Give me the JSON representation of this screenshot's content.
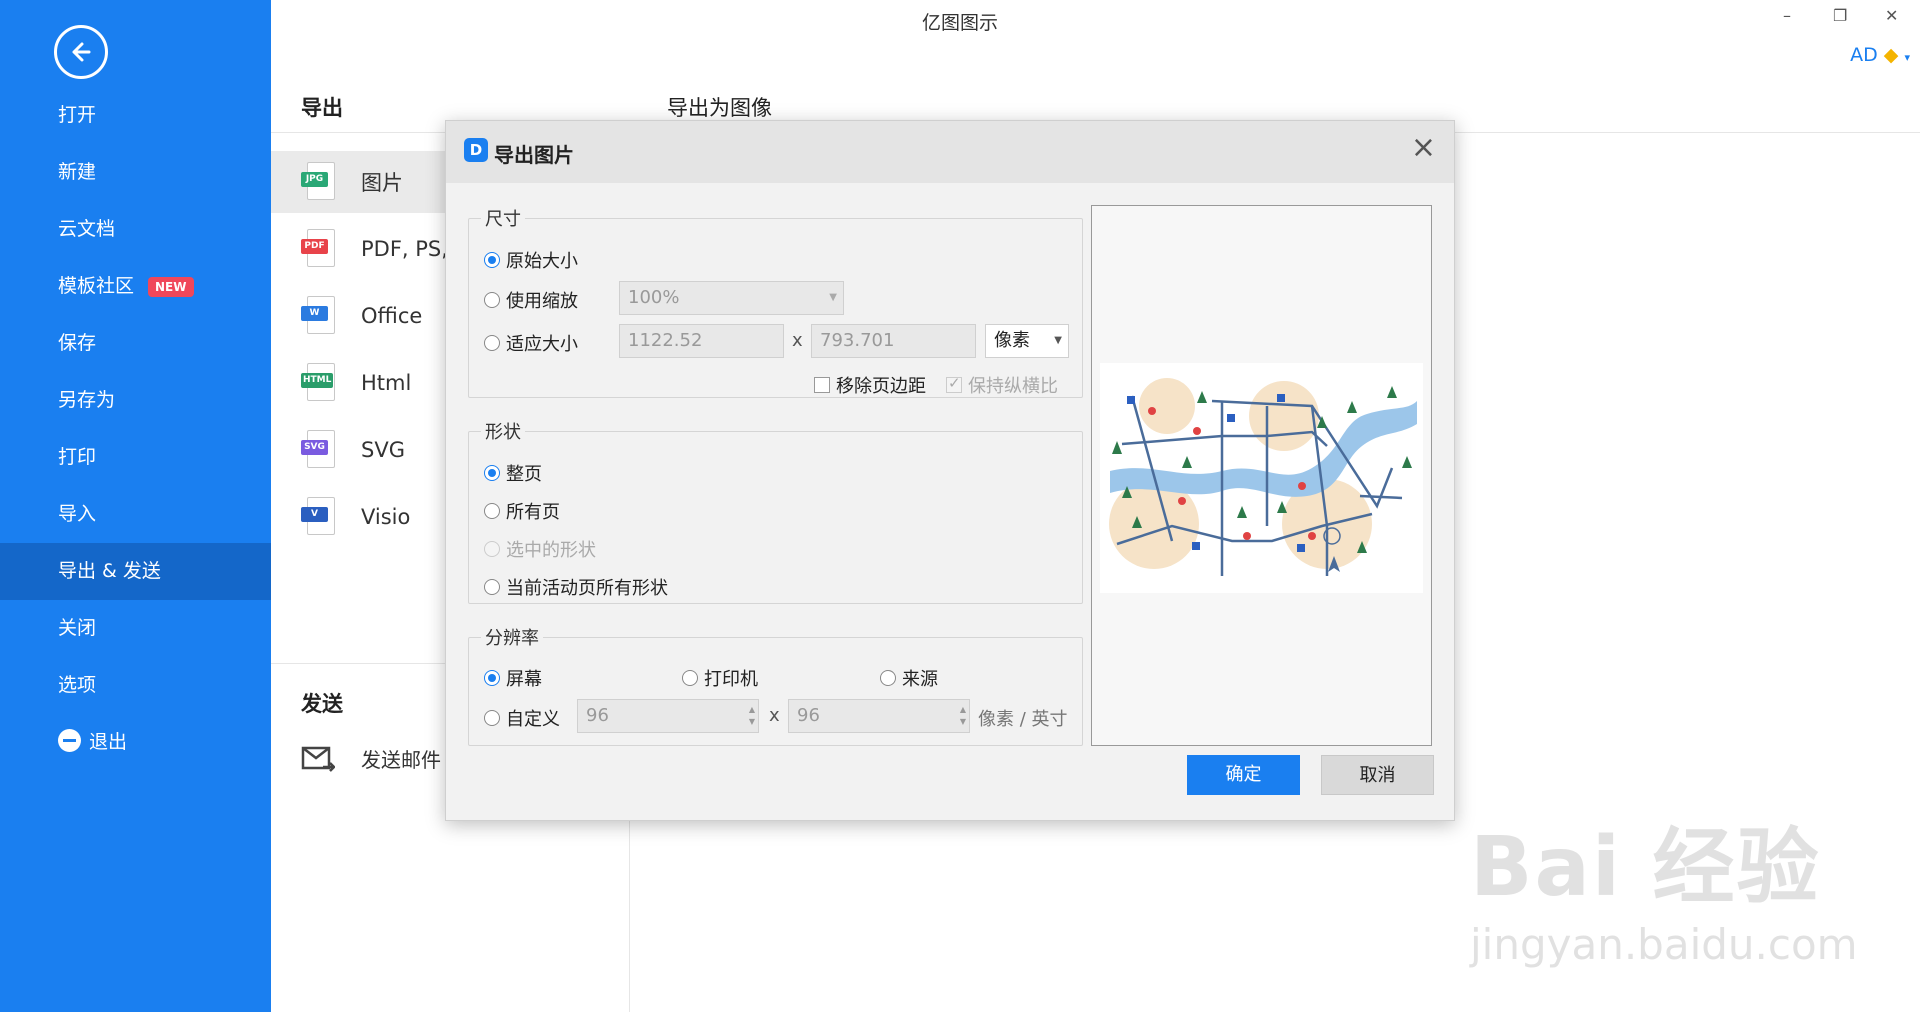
{
  "app": {
    "title": "亿图图示",
    "user": "AD"
  },
  "window_controls": {
    "minimize": "–",
    "restore": "❐",
    "close": "✕"
  },
  "sidebar": {
    "items": [
      {
        "label": "打开"
      },
      {
        "label": "新建"
      },
      {
        "label": "云文档"
      },
      {
        "label": "模板社区",
        "badge": "NEW"
      },
      {
        "label": "保存"
      },
      {
        "label": "另存为"
      },
      {
        "label": "打印"
      },
      {
        "label": "导入"
      },
      {
        "label": "导出 & 发送",
        "active": true
      },
      {
        "label": "关闭"
      },
      {
        "label": "选项"
      },
      {
        "label": "退出"
      }
    ]
  },
  "export": {
    "heading": "导出",
    "subheading": "导出为图像",
    "formats": [
      {
        "label": "图片",
        "tag": "JPG",
        "tag_color": "#2aa876",
        "active": true
      },
      {
        "label": "PDF, PS,",
        "tag": "PDF",
        "tag_color": "#e8434a"
      },
      {
        "label": "Office",
        "tag": "W",
        "tag_color": "#2b7be0"
      },
      {
        "label": "Html",
        "tag": "HTML",
        "tag_color": "#2a9d6a"
      },
      {
        "label": "SVG",
        "tag": "SVG",
        "tag_color": "#7a5be0"
      },
      {
        "label": "Visio",
        "tag": "V",
        "tag_color": "#2b5fc0"
      }
    ],
    "send_heading": "发送",
    "send_mail": "发送邮件"
  },
  "dialog": {
    "title": "导出图片",
    "size_group": {
      "legend": "尺寸",
      "original": "原始大小",
      "use_scale": "使用缩放",
      "scale_value": "100%",
      "fit_size": "适应大小",
      "width": "1122.52",
      "x": "x",
      "height": "793.701",
      "unit": "像素",
      "remove_margin": "移除页边距",
      "keep_ratio": "保持纵横比"
    },
    "shape_group": {
      "legend": "形状",
      "whole_page": "整页",
      "all_pages": "所有页",
      "selected_shapes": "选中的形状",
      "active_page_shapes": "当前活动页所有形状"
    },
    "resolution_group": {
      "legend": "分辨率",
      "screen": "屏幕",
      "printer": "打印机",
      "source": "来源",
      "custom": "自定义",
      "dpi_x": "96",
      "x": "x",
      "dpi_y": "96",
      "unit": "像素 / 英寸"
    },
    "ok": "确定",
    "cancel": "取消"
  },
  "watermark": {
    "brand": "Bai 经验",
    "url": "jingyan.baidu.com"
  }
}
